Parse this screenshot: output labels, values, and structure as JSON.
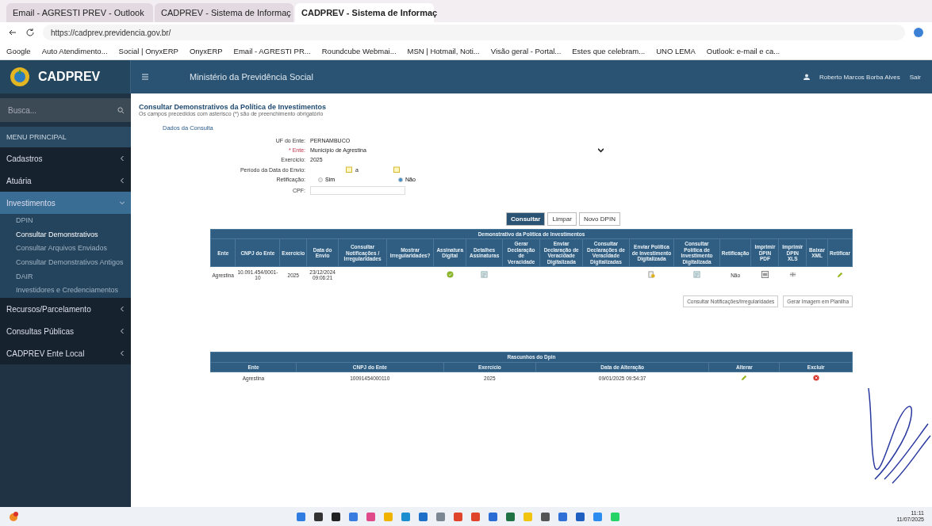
{
  "browser": {
    "tabs": [
      {
        "label": "Email - AGRESTI PREV - Outlook",
        "selected": false
      },
      {
        "label": "CADPREV - Sistema de Informaç",
        "selected": false
      },
      {
        "label": "CADPREV - Sistema de Informaç",
        "selected": true
      }
    ],
    "address": "https://cadprev.previdencia.gov.br/",
    "bookmarks": [
      "Google",
      "Auto Atendimento...",
      "Social | OnyxERP",
      "OnyxERP",
      "Email - AGRESTI PR...",
      "Roundcube Webmai...",
      "MSN | Hotmail, Noti...",
      "Visão geral - Portal...",
      "Estes que celebram...",
      "UNO LEMA",
      "Outlook: e-mail e ca..."
    ]
  },
  "header": {
    "brand": "CADPREV",
    "title": "Ministério da Previdência Social",
    "user": "Roberto Marcos Borba Alves",
    "logout": "Sair"
  },
  "sidebar": {
    "search_placeholder": "Busca...",
    "section": "MENU PRINCIPAL",
    "items": [
      {
        "label": "Cadastros",
        "expanded": false,
        "selected": false
      },
      {
        "label": "Atuária",
        "expanded": false,
        "selected": false
      },
      {
        "label": "Investimentos",
        "expanded": true,
        "selected": true,
        "children": [
          {
            "label": "DPIN",
            "selected": false
          },
          {
            "label": "Consultar Demonstrativos",
            "selected": true
          },
          {
            "label": "Consultar Arquivos Enviados",
            "selected": false
          },
          {
            "label": "Consultar Demonstrativos Antigos",
            "selected": false
          },
          {
            "label": "DAIR",
            "selected": false
          },
          {
            "label": "Investidores e Credenciamentos",
            "selected": false
          }
        ]
      },
      {
        "label": "Recursos/Parcelamento",
        "expanded": false,
        "selected": false
      },
      {
        "label": "Consultas Públicas",
        "expanded": false,
        "selected": false
      },
      {
        "label": "CADPREV Ente Local",
        "expanded": false,
        "selected": false
      }
    ]
  },
  "page": {
    "title": "Consultar Demonstrativos da Política de Investimentos",
    "subtitle": "Os campos precedidos com asterisco (*) são de preenchimento obrigatório",
    "section": "Dados da Consulta",
    "form": {
      "uf_label": "UF do Ente:",
      "uf_value": "PERNAMBUCO",
      "ente_label": "* Ente:",
      "ente_value": "Município de Agrestina",
      "exercicio_label": "Exercício:",
      "exercicio_value": "2025",
      "periodo_label": "Período da Data do Envio:",
      "periodo_sep": "a",
      "retificacao_label": "Retificação:",
      "options": [
        {
          "label": "Sim",
          "selected": false
        },
        {
          "label": "Não",
          "selected": true
        }
      ],
      "cpf_label": "CPF:"
    },
    "buttons": [
      {
        "label": "Consultar",
        "primary": true
      },
      {
        "label": "Limpar",
        "primary": false
      },
      {
        "label": "Novo DPIN",
        "primary": false
      }
    ]
  },
  "table": {
    "title": "Demonstrativo da Política de Investimentos",
    "columns": [
      "Ente",
      "CNPJ do Ente",
      "Exercício",
      "Data do Envio",
      "Consultar Notificações / Irregularidades",
      "Mostrar Irregularidades?",
      "Assinatura Digital",
      "Detalhes Assinaturas",
      "Gerar Declaração de Veracidade",
      "Enviar Declaração de Veracidade Digitalizada",
      "Consultar Declarações de Veracidade Digitalizadas",
      "Enviar Política de Investimento Digitalizada",
      "Consultar Política de Investimento Digitalizada",
      "Retificação",
      "Imprimir DPIN PDF",
      "Imprimir DPIN XLS",
      "Baixar XML",
      "Retificar"
    ],
    "rows": [
      [
        {
          "kind": "text",
          "text": "Agrestina"
        },
        {
          "kind": "text",
          "text": "10.091.454/0001-10"
        },
        {
          "kind": "text",
          "text": "2025"
        },
        {
          "kind": "text",
          "text": "23/12/2024 09:06:21"
        },
        {
          "kind": "empty"
        },
        {
          "kind": "empty"
        },
        {
          "kind": "check"
        },
        {
          "kind": "list"
        },
        {
          "kind": "empty"
        },
        {
          "kind": "empty"
        },
        {
          "kind": "empty"
        },
        {
          "kind": "upload"
        },
        {
          "kind": "list"
        },
        {
          "kind": "text",
          "text": "Não"
        },
        {
          "kind": "pdf"
        },
        {
          "kind": "xls"
        },
        {
          "kind": "empty"
        },
        {
          "kind": "edit"
        }
      ]
    ]
  },
  "table_actions": [
    "Consultar Notificações/Irregularidades",
    "Gerar Imagem em Planilha"
  ],
  "drafts": {
    "title": "Rascunhos do Dpin",
    "columns": [
      "Ente",
      "CNPJ do Ente",
      "Exercício",
      "Data de Alteração",
      "Alterar",
      "Excluir"
    ],
    "rows": [
      [
        {
          "kind": "text",
          "text": "Agrestina"
        },
        {
          "kind": "text",
          "text": "10091454000110"
        },
        {
          "kind": "text",
          "text": "2025"
        },
        {
          "kind": "text",
          "text": "09/01/2025 09:54:37"
        },
        {
          "kind": "edit"
        },
        {
          "kind": "delete"
        }
      ]
    ]
  },
  "taskbar": {
    "time": "11:11",
    "date": "11/07/2025"
  }
}
